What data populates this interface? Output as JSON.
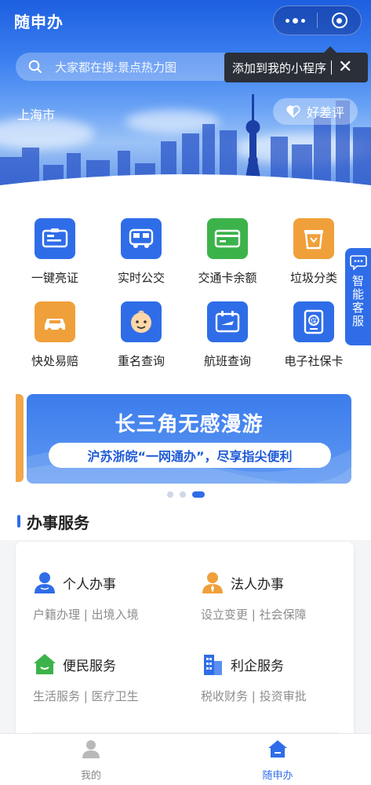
{
  "header": {
    "app_title": "随申办",
    "capsule_more_icon": "more-dots-icon",
    "capsule_close_icon": "target-circle-icon"
  },
  "search": {
    "icon": "search-icon",
    "placeholder_text": "大家都在搜:景点热力图"
  },
  "tooltip": {
    "text": "添加到我的小程序",
    "close_icon": "close-icon"
  },
  "hero": {
    "city": "上海市",
    "rating_label": "好差评",
    "rating_icon": "heart-half-icon"
  },
  "services_grid": [
    {
      "label": "一键亮证",
      "icon": "id-card-icon",
      "color": "#2f6de8"
    },
    {
      "label": "实时公交",
      "icon": "bus-icon",
      "color": "#2f6de8"
    },
    {
      "label": "交通卡余额",
      "icon": "card-icon",
      "color": "#3cb34a"
    },
    {
      "label": "垃圾分类",
      "icon": "trash-bin-icon",
      "color": "#f0a03a"
    },
    {
      "label": "快处易赔",
      "icon": "car-accident-icon",
      "color": "#f0a03a"
    },
    {
      "label": "重名查询",
      "icon": "baby-face-icon",
      "color": "#2f6de8"
    },
    {
      "label": "航班查询",
      "icon": "flight-calendar-icon",
      "color": "#2f6de8"
    },
    {
      "label": "电子社保卡",
      "icon": "social-security-card-icon",
      "color": "#2f6de8"
    }
  ],
  "side_service": {
    "label": "智能客服",
    "icon": "chat-bubble-icon"
  },
  "banner": {
    "title": "长三角无感漫游",
    "subtitle": "沪苏浙皖“一网通办”，尽享指尖便利",
    "active_index": 3,
    "count": 3
  },
  "section": {
    "title": "办事服务"
  },
  "service_cards": [
    {
      "name": "个人办事",
      "sub": "户籍办理 | 出境入境",
      "icon": "person-icon",
      "color": "#2f6de8"
    },
    {
      "name": "法人办事",
      "sub": "设立变更 | 社会保障",
      "icon": "business-person-icon",
      "color": "#f0a03a"
    },
    {
      "name": "便民服务",
      "sub": "生活服务 | 医疗卫生",
      "icon": "home-smile-icon",
      "color": "#3cb34a"
    },
    {
      "name": "利企服务",
      "sub": "税收财务 | 投资审批",
      "icon": "building-icon",
      "color": "#2f6de8"
    }
  ],
  "tabbar": {
    "tabs": [
      {
        "label": "我的",
        "icon": "user-icon",
        "active": false
      },
      {
        "label": "随申办",
        "icon": "home-icon",
        "active": true
      }
    ]
  },
  "colors": {
    "primary": "#2f6de8",
    "green": "#3cb34a",
    "orange": "#f0a03a",
    "text_gray": "#8d8d8d"
  }
}
